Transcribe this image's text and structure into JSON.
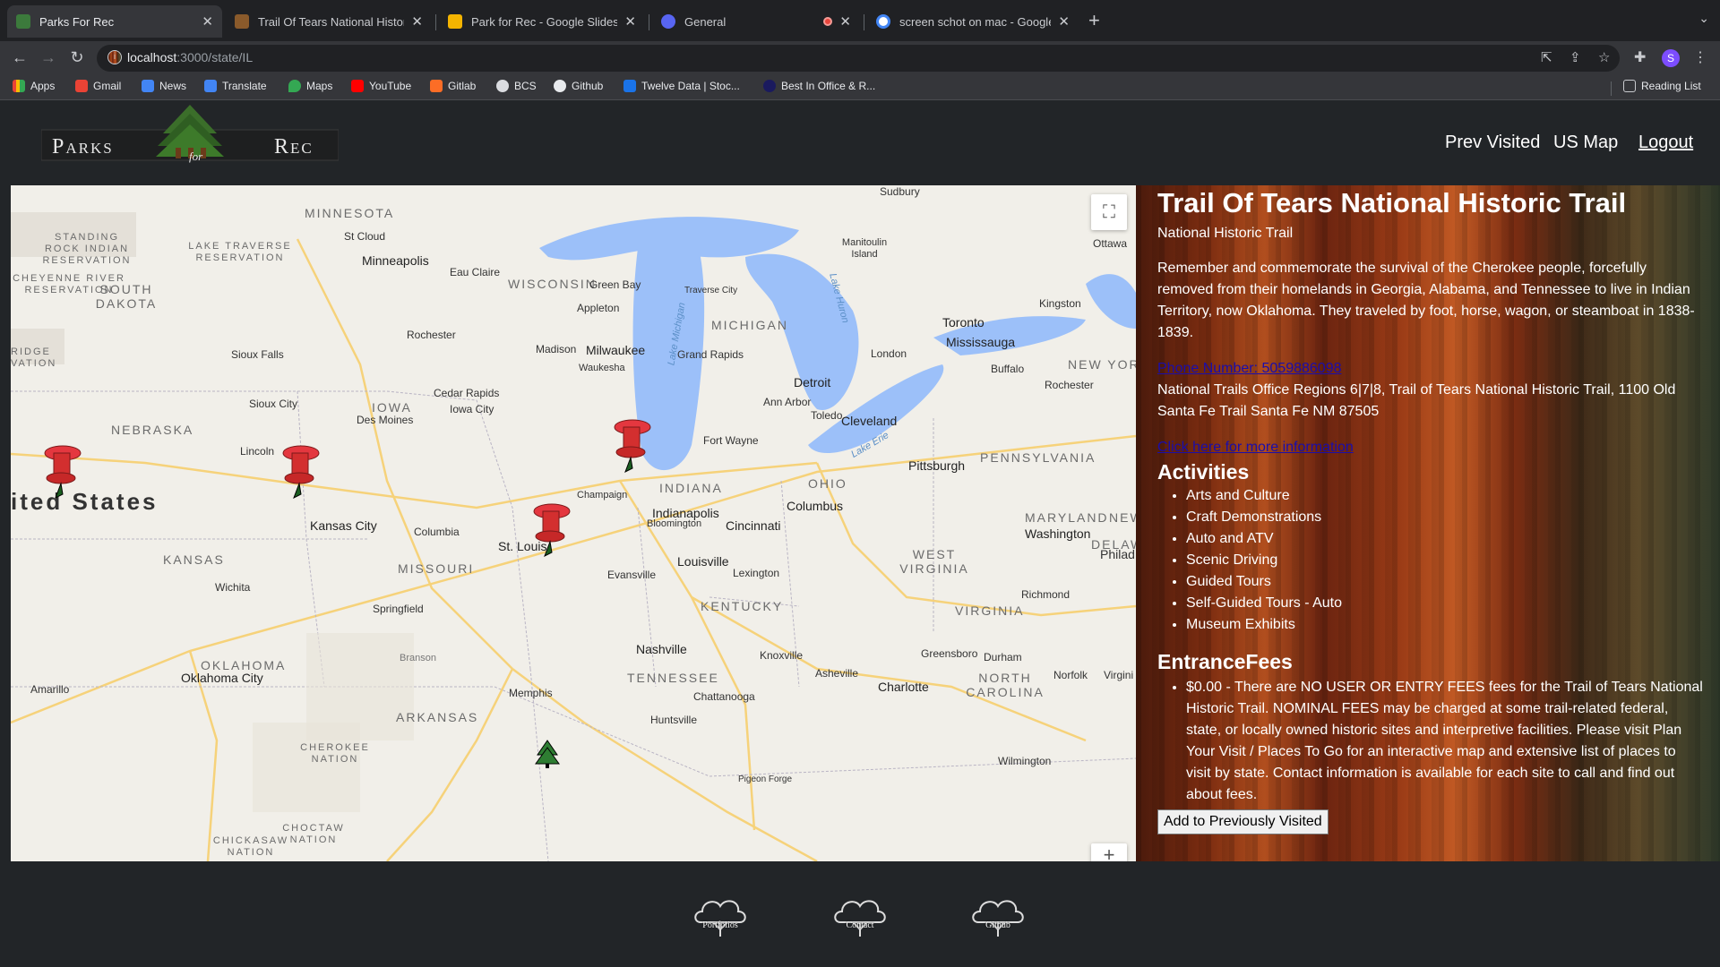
{
  "browser": {
    "tabs": [
      {
        "title": "Parks For Rec",
        "active": true
      },
      {
        "title": "Trail Of Tears National Historic",
        "active": false
      },
      {
        "title": "Park for Rec - Google Slides",
        "active": false
      },
      {
        "title": "General",
        "active": false
      },
      {
        "title": "screen schot on mac - Google",
        "active": false
      }
    ],
    "url_host": "localhost",
    "url_path": ":3000/state/IL",
    "profile_initial": "S",
    "bookmarks": [
      "Apps",
      "Gmail",
      "News",
      "Translate",
      "Maps",
      "YouTube",
      "Gitlab",
      "BCS",
      "Github",
      "Twelve Data | Stoc...",
      "Best In Office & R..."
    ],
    "reading_list": "Reading List"
  },
  "header": {
    "logo_left": "Parks",
    "logo_for": "for",
    "logo_right": "Rec",
    "nav": [
      "Prev Visited",
      "US Map",
      "Logout"
    ]
  },
  "map": {
    "country_label": "ited States",
    "states": [
      "MINNESOTA",
      "SOUTH DAKOTA",
      "NEBRASKA",
      "IOWA",
      "WISCONSIN",
      "MICHIGAN",
      "KANSAS",
      "MISSOURI",
      "INDIANA",
      "OHIO",
      "KENTUCKY",
      "TENNESSEE",
      "ARKANSAS",
      "OKLAHOMA",
      "WEST VIRGINIA",
      "VIRGINIA",
      "NORTH CAROLINA",
      "PENNSYLVANIA",
      "MARYLAND",
      "NEW YORK",
      "DELAW",
      "NEW"
    ],
    "cities": [
      "Minneapolis",
      "St Cloud",
      "Eau Claire",
      "Rochester",
      "Sioux Falls",
      "Sioux City",
      "Des Moines",
      "Cedar Rapids",
      "Iowa City",
      "Lincoln",
      "Kansas City",
      "Columbia",
      "St. Louis",
      "Springfield",
      "Wichita",
      "Oklahoma City",
      "Amarillo",
      "Memphis",
      "Nashville",
      "Louisville",
      "Indianapolis",
      "Cincinnati",
      "Columbus",
      "Cleveland",
      "Detroit",
      "Toledo",
      "Ann Arbor",
      "Fort Wayne",
      "Milwaukee",
      "Madison",
      "Green Bay",
      "Appleton",
      "Grand Rapids",
      "Toronto",
      "Mississauga",
      "London",
      "Pittsburgh",
      "Washington",
      "Richmond",
      "Charlotte",
      "Greensboro",
      "Durham",
      "Knoxville",
      "Asheville",
      "Chattanooga",
      "Huntsville",
      "Evansville",
      "Lexington",
      "Bloomington",
      "Champaign",
      "Branson",
      "Ottawa",
      "Kingston",
      "Sudbury",
      "Waukesha",
      "Buffalo",
      "Rochester",
      "Wilmington",
      "Norfolk",
      "Virgini",
      "Philad",
      "Pigeon Forge"
    ],
    "regions": [
      "STANDING ROCK INDIAN RESERVATION",
      "LAKE TRAVERSE RESERVATION",
      "CHEYENNE RIVER RESERVATION",
      "RIDGE VATION",
      "CHEROKEE NATION",
      "CHOCTAW NATION",
      "CHICKASAW NATION"
    ],
    "water": [
      "Lake Michigan",
      "Lake Huron",
      "Lake Erie",
      "Manitoulin Island",
      "Traverse City"
    ],
    "fullscreen_icon": "expand-icon"
  },
  "park": {
    "title": "Trail Of Tears National Historic Trail",
    "designation": "National Historic Trail",
    "description": "Remember and commemorate the survival of the Cherokee people, forcefully removed from their homelands in Georgia, Alabama, and Tennessee to live in Indian Territory, now Oklahoma. They traveled by foot, horse, wagon, or steamboat in 1838-1839.",
    "phone": "Phone Number: 5059886098",
    "address": "National Trails Office Regions 6|7|8, Trail of Tears National Historic Trail, 1100 Old Santa Fe Trail Santa Fe NM 87505",
    "more_info": "Click here for more information",
    "activities_heading": "Activities",
    "activities": [
      "Arts and Culture",
      "Craft Demonstrations",
      "Auto and ATV",
      "Scenic Driving",
      "Guided Tours",
      "Self-Guided Tours - Auto",
      "Museum Exhibits"
    ],
    "fees_heading": "EntranceFees",
    "fees": [
      "$0.00 - There are NO USER OR ENTRY FEES fees for the Trail of Tears National Historic Trail. NOMINAL FEES may be charged at some trail-related federal, state, or locally owned historic sites and interpretive facilities. Please visit Plan Your Visit / Places To Go for an interactive map and extensive list of places to visit by state. Contact information is available for each site to call and find out about fees."
    ],
    "add_button": "Add to Previously Visited"
  },
  "footer": [
    "Portfolios",
    "Contact",
    "Github"
  ]
}
